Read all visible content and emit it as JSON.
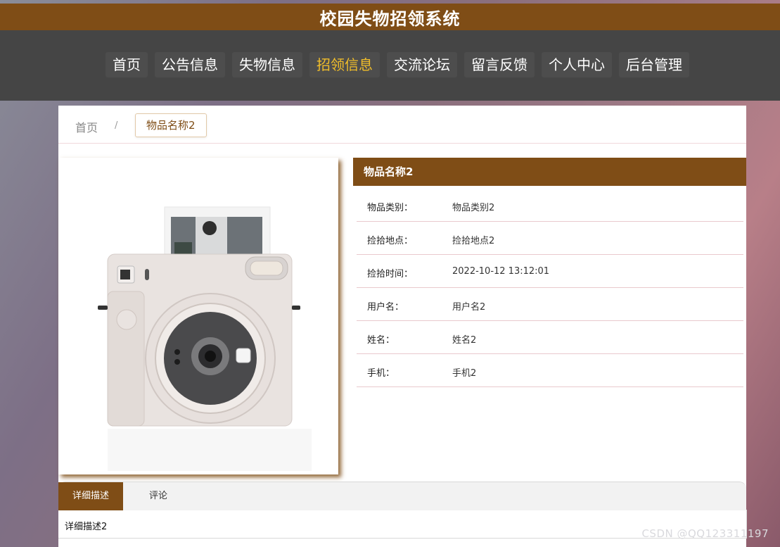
{
  "header": {
    "title": "校园失物招领系统"
  },
  "nav": {
    "items": [
      {
        "label": "首页"
      },
      {
        "label": "公告信息"
      },
      {
        "label": "失物信息"
      },
      {
        "label": "招领信息"
      },
      {
        "label": "交流论坛"
      },
      {
        "label": "留言反馈"
      },
      {
        "label": "个人中心"
      },
      {
        "label": "后台管理"
      }
    ],
    "active_color": "#f0bd2a"
  },
  "breadcrumb": {
    "home": "首页",
    "separator": "/",
    "current": "物品名称2"
  },
  "detail": {
    "title": "物品名称2",
    "fields": [
      {
        "label": "物品类别：",
        "value": "物品类别2"
      },
      {
        "label": "捡拾地点：",
        "value": "捡拾地点2"
      },
      {
        "label": "捡拾时间：",
        "value": "2022-10-12 13:12:01"
      },
      {
        "label": "用户名：",
        "value": "用户名2"
      },
      {
        "label": "姓名：",
        "value": "姓名2"
      },
      {
        "label": "手机：",
        "value": "手机2"
      }
    ]
  },
  "tabs": {
    "active": "详细描述",
    "other": "评论",
    "content": "详细描述2"
  },
  "watermark": "CSDN @QQ123311197",
  "colors": {
    "brand": "#7f4d16",
    "navbar": "#454545"
  }
}
